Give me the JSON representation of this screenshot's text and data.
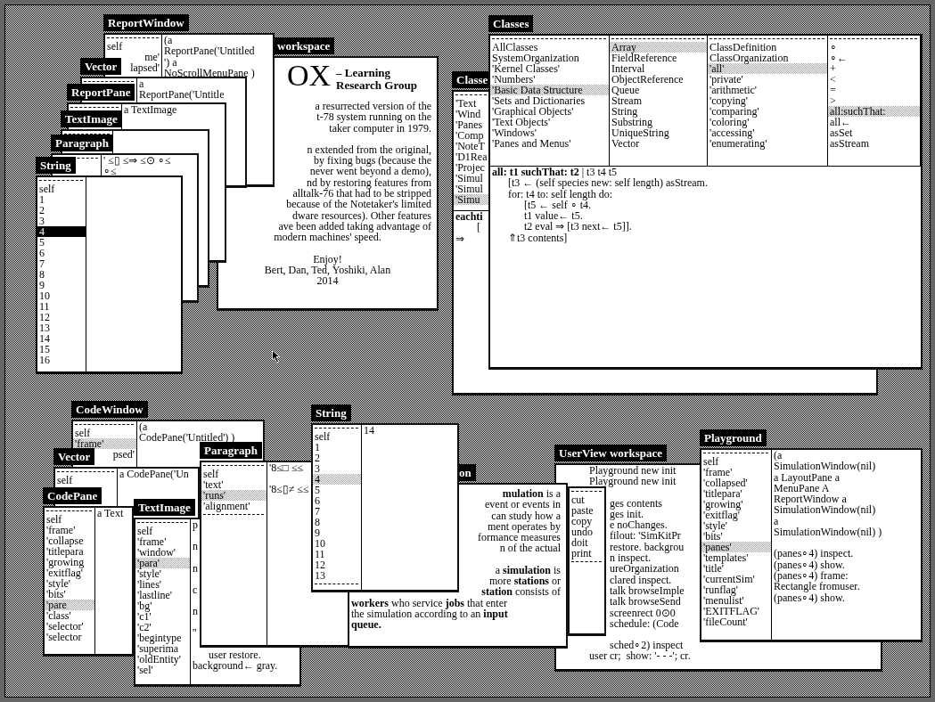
{
  "desktop": {
    "windows": [
      {
        "kind": "window",
        "title": "Classe",
        "active": false,
        "panes": [
          {
            "kind": "list",
            "items": [
              {
                "text": "'Text",
                "selected": false
              },
              {
                "text": "'Wind",
                "selected": false
              },
              {
                "text": "'Panes",
                "selected": false
              },
              {
                "text": "'Comp",
                "selected": false
              },
              {
                "text": "'NoteT",
                "selected": false
              },
              {
                "text": "'D1Rea",
                "selected": false
              },
              {
                "text": "'Projec",
                "selected": false
              },
              {
                "text": "'Simul",
                "selected": false
              },
              {
                "text": "'Simul",
                "selected": false
              },
              {
                "text": "'Simu",
                "selected": true
              }
            ]
          },
          {
            "kind": "code",
            "lines": [
              {
                "text": "eachti",
                "bold": true
              },
              "        [",
              "⇒"
            ]
          }
        ]
      },
      {
        "kind": "window",
        "title": "Classes",
        "active": false,
        "panes": [
          {
            "kind": "list",
            "items": [
              {
                "text": "AllClasses",
                "selected": false
              },
              {
                "text": "SystemOrganization",
                "selected": false
              },
              {
                "text": "'Kernel Classes'",
                "selected": false
              },
              {
                "text": "'Numbers'",
                "selected": false
              },
              {
                "text": "'Basic Data Structure",
                "selected": true
              },
              {
                "text": "'Sets and Dictionaries",
                "selected": false
              },
              {
                "text": "'Graphical Objects'",
                "selected": false
              },
              {
                "text": "'Text Objects'",
                "selected": false
              },
              {
                "text": "'Windows'",
                "selected": false
              },
              {
                "text": "'Panes and Menus'",
                "selected": false
              }
            ]
          },
          {
            "kind": "list",
            "items": [
              {
                "text": "Array",
                "selected": true
              },
              {
                "text": "FieldReference",
                "selected": false
              },
              {
                "text": "Interval",
                "selected": false
              },
              {
                "text": "ObjectReference",
                "selected": false
              },
              {
                "text": "Queue",
                "selected": false
              },
              {
                "text": "Stream",
                "selected": false
              },
              {
                "text": "String",
                "selected": false
              },
              {
                "text": "Substring",
                "selected": false
              },
              {
                "text": "UniqueString",
                "selected": false
              },
              {
                "text": "Vector",
                "selected": false
              }
            ]
          },
          {
            "kind": "list",
            "items": [
              {
                "text": "ClassDefinition",
                "selected": false
              },
              {
                "text": "ClassOrganization",
                "selected": false
              },
              {
                "text": "'all'",
                "selected": true
              },
              {
                "text": "'private'",
                "selected": false
              },
              {
                "text": "'arithmetic'",
                "selected": false
              },
              {
                "text": "'copying'",
                "selected": false
              },
              {
                "text": "'comparing'",
                "selected": false
              },
              {
                "text": "'coloring'",
                "selected": false
              },
              {
                "text": "'accessing'",
                "selected": false
              },
              {
                "text": "'enumerating'",
                "selected": false
              }
            ]
          },
          {
            "kind": "list",
            "items": [
              {
                "text": "∘",
                "selected": false
              },
              {
                "text": "∘←",
                "selected": false
              },
              {
                "text": "+",
                "selected": false
              },
              {
                "text": "<",
                "selected": false
              },
              {
                "text": "=",
                "selected": false
              },
              {
                "text": ">",
                "selected": false
              },
              {
                "text": "all:suchThat:",
                "selected": true
              },
              {
                "text": "all←",
                "selected": false
              },
              {
                "text": "asSet",
                "selected": false
              },
              {
                "text": "asStream",
                "selected": false
              }
            ]
          },
          {
            "kind": "code",
            "lines": [
              "**all: t1 suchThat: t2** | t3 t4 t5",
              "      [t3 ← (self species new: self length) asStream.",
              "      for: t4 to: self length do:",
              "            [t5 ← self ∘ t4.",
              "            t1 value← t5.",
              "            t2 eval ⇒ [t3 next← t5]].",
              "      ⇑t3 contents]"
            ]
          }
        ]
      },
      {
        "kind": "window",
        "title": "workspace",
        "active": false,
        "panes": [
          {
            "kind": "doc",
            "logo": "OX",
            "subtitle": "– Learning Research Group",
            "lines": [
              {
                "text": "a resurrected version of the",
                "cut_left": true
              },
              {
                "text": "t-78 system running on the",
                "cut_left": true
              },
              {
                "text": "taker computer in 1979.",
                "cut_left": true
              },
              {
                "text": "n extended from the original,",
                "cut_left": true,
                "gap": true
              },
              {
                "text": "by fixing bugs (because the",
                "cut_left": true
              },
              {
                "text": "never went beyond a demo),",
                "cut_left": true
              },
              {
                "text": "nd by restoring features from",
                "cut_left": true
              },
              {
                "text": "alltalk-76 that had to be stripped",
                "cut_left": true
              },
              {
                "text": "because of the Notetaker's limited",
                "cut_left": true
              },
              {
                "text": "dware resources). Other features",
                "cut_left": true
              },
              {
                "text": "ave been added taking advantage of",
                "cut_left": true
              },
              {
                "text": "modern machines' speed.",
                "centered": true
              },
              {
                "text": "Enjoy!",
                "centered": true,
                "gap": true
              },
              {
                "text": "Bert, Dan, Ted, Yoshiki, Alan",
                "centered": true
              },
              {
                "text": "2014",
                "centered": true
              }
            ]
          }
        ]
      },
      {
        "kind": "window",
        "title": "ReportWindow",
        "active": false,
        "panes": [
          {
            "kind": "list",
            "items": [
              {
                "text": "self",
                "selected": false
              },
              {
                "text": "me'",
                "selected": false,
                "cut_left": true
              },
              {
                "text": "lapsed'",
                "selected": false,
                "cut_left": true
              }
            ]
          },
          {
            "kind": "text",
            "lines": [
              "(a",
              "ReportPane('Untitled",
              "') a",
              "NoScrollMenuPane )"
            ]
          }
        ]
      },
      {
        "kind": "window",
        "title": "Vector",
        "active": false,
        "panes": [
          {
            "kind": "list"
          },
          {
            "kind": "text",
            "lines": [
              "a",
              "ReportPane('Untitle"
            ]
          }
        ]
      },
      {
        "kind": "window",
        "title": "ReportPane",
        "active": false,
        "panes": [
          {
            "kind": "list"
          },
          {
            "kind": "text",
            "lines": [
              "a TextImage"
            ]
          }
        ]
      },
      {
        "kind": "window",
        "title": "TextImage",
        "active": false,
        "panes": [
          {
            "kind": "list"
          },
          {
            "kind": "text"
          }
        ]
      },
      {
        "kind": "window",
        "title": "Paragraph",
        "active": false,
        "panes": [
          {
            "kind": "list"
          },
          {
            "kind": "text",
            "lines": [
              "' ≤▯ ≤⇒ ≤⊙ ∘≤",
              "∘≤"
            ]
          }
        ]
      },
      {
        "kind": "window",
        "title": "String",
        "active": true,
        "panes": [
          {
            "kind": "list",
            "items": [
              {
                "text": "self",
                "selected": false
              },
              {
                "text": "1",
                "selected": false
              },
              {
                "text": "2",
                "selected": false
              },
              {
                "text": "3",
                "selected": false
              },
              {
                "text": "4",
                "selected": true
              },
              {
                "text": "5",
                "selected": false
              },
              {
                "text": "6",
                "selected": false
              },
              {
                "text": "7",
                "selected": false
              },
              {
                "text": "8",
                "selected": false
              },
              {
                "text": "9",
                "selected": false
              },
              {
                "text": "10",
                "selected": false
              },
              {
                "text": "11",
                "selected": false
              },
              {
                "text": "12",
                "selected": false
              },
              {
                "text": "13",
                "selected": false
              },
              {
                "text": "14",
                "selected": false
              },
              {
                "text": "15",
                "selected": false
              },
              {
                "text": "16",
                "selected": false
              }
            ]
          },
          {
            "kind": "text"
          }
        ]
      },
      {
        "kind": "window",
        "title": "CodeWindow",
        "active": false,
        "panes": [
          {
            "kind": "list",
            "items": [
              {
                "text": "self",
                "selected": false
              },
              {
                "text": "'frame'",
                "selected": true
              },
              {
                "text": "psed'",
                "selected": false,
                "cut_left": true
              }
            ]
          },
          {
            "kind": "text",
            "lines": [
              "(a",
              "CodePane('Untitled') )"
            ]
          }
        ]
      },
      {
        "kind": "window",
        "title": "Vector",
        "active": false,
        "panes": [
          {
            "kind": "list",
            "items": [
              {
                "text": "self",
                "selected": false
              }
            ]
          },
          {
            "kind": "text",
            "lines": [
              "a CodePane('Un"
            ]
          }
        ]
      },
      {
        "kind": "window",
        "title": "CodePane",
        "active": false,
        "panes": [
          {
            "kind": "list",
            "items": [
              {
                "text": "self",
                "selected": false
              },
              {
                "text": "'frame'",
                "selected": false
              },
              {
                "text": "'collapse",
                "selected": false
              },
              {
                "text": "'titlepara",
                "selected": false
              },
              {
                "text": "'growing",
                "selected": false
              },
              {
                "text": "'exitflag'",
                "selected": false
              },
              {
                "text": "'style'",
                "selected": false
              },
              {
                "text": "'bits'",
                "selected": false
              },
              {
                "text": "'pare",
                "selected": true
              },
              {
                "text": "'class'",
                "selected": false
              },
              {
                "text": "'selector'",
                "selected": false
              },
              {
                "text": "'selector",
                "selected": false
              }
            ]
          },
          {
            "kind": "text",
            "lines": [
              "a Text"
            ]
          }
        ]
      },
      {
        "kind": "window",
        "title": "TextImage",
        "active": false,
        "panes": [
          {
            "kind": "list",
            "items": [
              {
                "text": "self",
                "selected": false
              },
              {
                "text": "'frame'",
                "selected": false
              },
              {
                "text": "'window'",
                "selected": false
              },
              {
                "text": "'para'",
                "selected": true
              },
              {
                "text": "'style'",
                "selected": false
              },
              {
                "text": "'lines'",
                "selected": false
              },
              {
                "text": "'lastline'",
                "selected": false
              },
              {
                "text": "'bg'",
                "selected": false
              },
              {
                "text": "'c1'",
                "selected": false
              },
              {
                "text": "'c2'",
                "selected": false
              },
              {
                "text": "'begintype",
                "selected": false
              },
              {
                "text": "'superima",
                "selected": false
              },
              {
                "text": "'oldEntity'",
                "selected": false
              },
              {
                "text": "'sel'",
                "selected": false
              }
            ]
          },
          {
            "kind": "text",
            "lines": [
              "p",
              {
                "text": "n",
                "gap": true
              },
              {
                "text": "n",
                "gap": true
              },
              {
                "text": "c",
                "gap": true
              },
              {
                "text": "n",
                "gap": true
              },
              {
                "text": "''",
                "gap": true
              },
              {
                "text": "      user restore.",
                "gap": true
              },
              "background← gray."
            ]
          }
        ]
      },
      {
        "kind": "window",
        "title": "Paragraph",
        "active": false,
        "panes": [
          {
            "kind": "list",
            "bottom_rule": true,
            "items": [
              {
                "text": "self",
                "selected": false
              },
              {
                "text": "'text'",
                "selected": false
              },
              {
                "text": "'runs'",
                "selected": true
              },
              {
                "text": "'alignment'",
                "selected": false
              }
            ]
          },
          {
            "kind": "text",
            "lines": [
              "'8≤□ ≤≤",
              {
                "text": "'8≤▯≠ ≤≤",
                "gap": true
              }
            ]
          }
        ]
      },
      {
        "kind": "window",
        "title": "on",
        "active": false,
        "panes": [
          {
            "kind": "text",
            "lines": [
              {
                "text": "**mulation** is a",
                "cut_left": true
              },
              {
                "text": "event or events in",
                "cut_left": true
              },
              {
                "text": "can study how a",
                "cut_left": true
              },
              {
                "text": "ment operates by",
                "cut_left": true
              },
              {
                "text": "formance measures",
                "cut_left": true
              },
              {
                "text": "n of the actual",
                "cut_left": true
              },
              {
                "text": "a **simulation** is",
                "cut_left": true,
                "gap": true
              },
              {
                "text": "more **stations** or",
                "cut_left": true
              },
              {
                "text": "**station** consists of",
                "cut_left": true
              },
              "**workers** who service **jobs** that enter",
              "the simulation according to an **input**",
              {
                "text": "queue.",
                "bold": true
              }
            ]
          }
        ]
      },
      {
        "kind": "window",
        "title": "UserView workspace",
        "active": false,
        "panes": [
          {
            "kind": "text",
            "lines": [
              "Playground new init",
              "Playground new init",
              {
                "text": "ges contents",
                "cut_left": true,
                "gap": true
              },
              {
                "text": "ges init.",
                "cut_left": true
              },
              {
                "text": "e noChanges.",
                "cut_left": true
              },
              {
                "text": "filout: 'SimKitPr",
                "cut_left": true
              },
              {
                "text": "restore. backgrou",
                "cut_left": true
              },
              {
                "text": "n inspect.",
                "cut_left": true
              },
              {
                "text": "ureOrganization",
                "cut_left": true
              },
              {
                "text": "clared inspect.",
                "cut_left": true
              },
              {
                "text": "talk browseImple",
                "cut_left": true
              },
              {
                "text": "talk browseSend",
                "cut_left": true
              },
              {
                "text": "screenrect 0⊙0",
                "cut_left": true
              },
              {
                "text": "schedule: (Code",
                "cut_left": true
              },
              {
                "text": "sched∘2) inspect",
                "cut_left": true,
                "gap": true
              },
              "user cr;  show: '- - -'; cr."
            ]
          }
        ]
      },
      {
        "kind": "menu",
        "active": false,
        "panes": [
          {
            "kind": "list",
            "bottom_rule": true,
            "items": [
              {
                "text": "cut",
                "selected": false
              },
              {
                "text": "paste",
                "selected": false
              },
              {
                "text": "copy",
                "selected": false
              },
              {
                "text": "undo",
                "selected": false
              },
              {
                "text": "doit",
                "selected": false
              },
              {
                "text": "print",
                "selected": false
              }
            ]
          }
        ]
      },
      {
        "kind": "window",
        "title": "String",
        "active": false,
        "panes": [
          {
            "kind": "list",
            "bottom_rule": true,
            "items": [
              {
                "text": "self",
                "selected": false
              },
              {
                "text": "1",
                "selected": false
              },
              {
                "text": "2",
                "selected": false
              },
              {
                "text": "3",
                "selected": false
              },
              {
                "text": "4",
                "selected": true
              },
              {
                "text": "5",
                "selected": false
              },
              {
                "text": "6",
                "selected": false
              },
              {
                "text": "7",
                "selected": false
              },
              {
                "text": "8",
                "selected": false
              },
              {
                "text": "9",
                "selected": false
              },
              {
                "text": "10",
                "selected": false
              },
              {
                "text": "11",
                "selected": false
              },
              {
                "text": "12",
                "selected": false
              },
              {
                "text": "13",
                "selected": false
              }
            ]
          },
          {
            "kind": "text",
            "lines": [
              "14"
            ]
          }
        ]
      },
      {
        "kind": "window",
        "title": "Playground",
        "active": false,
        "panes": [
          {
            "kind": "list",
            "items": [
              {
                "text": "self",
                "selected": false
              },
              {
                "text": "'frame'",
                "selected": false
              },
              {
                "text": "'collapsed'",
                "selected": false
              },
              {
                "text": "'titlepara'",
                "selected": false
              },
              {
                "text": "'growing'",
                "selected": false
              },
              {
                "text": "'exitflag'",
                "selected": false
              },
              {
                "text": "'style'",
                "selected": false
              },
              {
                "text": "'bits'",
                "selected": false
              },
              {
                "text": "'panes'",
                "selected": true
              },
              {
                "text": "'templates'",
                "selected": false
              },
              {
                "text": "'title'",
                "selected": false
              },
              {
                "text": "'currentSim'",
                "selected": false
              },
              {
                "text": "'runflag'",
                "selected": false
              },
              {
                "text": "'menulist'",
                "selected": false
              },
              {
                "text": "'EXITFLAG'",
                "selected": false
              },
              {
                "text": "'fileCount'",
                "selected": false
              }
            ]
          },
          {
            "kind": "text",
            "lines": [
              "(a",
              "SimulationWindow(nil)",
              "a LayoutPane a",
              "MenuPane A",
              "ReportWindow a",
              "SimulationWindow(nil)",
              "a",
              "SimulationWindow(nil) )",
              {
                "text": "(panes∘4) inspect.",
                "gap": true
              },
              "(panes∘4) show.",
              "(panes∘4) frame:",
              "Rectangle fromuser.",
              "(panes∘4) show."
            ]
          }
        ]
      }
    ]
  }
}
